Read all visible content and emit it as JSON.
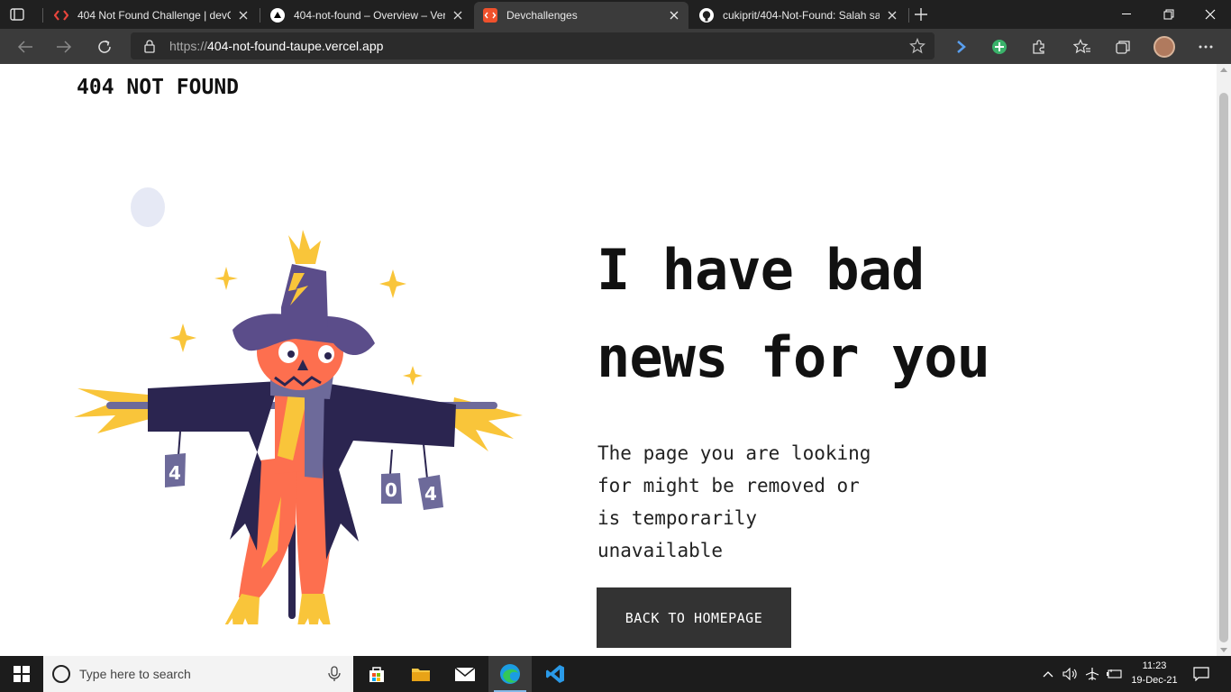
{
  "browser": {
    "tabs": [
      {
        "title": "404 Not Found Challenge | devC",
        "favicon": "devchallenges-red-icon",
        "active": false
      },
      {
        "title": "404-not-found – Overview – Verc",
        "favicon": "vercel-icon",
        "active": false
      },
      {
        "title": "Devchallenges",
        "favicon": "devchallenges-orange-icon",
        "active": true
      },
      {
        "title": "cukiprit/404-Not-Found: Salah sa",
        "favicon": "github-icon",
        "active": false
      }
    ],
    "url_prefix": "https://",
    "url_host": "404-not-found-taupe.vercel.app"
  },
  "page": {
    "brand": "404 NOT FOUND",
    "headline_line1": "I have bad",
    "headline_line2": "news for you",
    "desc_line1": "The page you are looking",
    "desc_line2": "for might be removed or",
    "desc_line3": "is temporarily",
    "desc_line4": "unavailable",
    "cta_label": "BACK TO HOMEPAGE",
    "illustration": {
      "can_labels": [
        "4",
        "0",
        "4"
      ]
    }
  },
  "taskbar": {
    "search_placeholder": "Type here to search",
    "time": "11:23",
    "date": "19-Dec-21"
  },
  "colors": {
    "cta_bg": "#333333",
    "hat": "#5b4d8a",
    "face": "#fd6f4f",
    "coat": "#2b2550",
    "straw": "#f9c53a"
  }
}
